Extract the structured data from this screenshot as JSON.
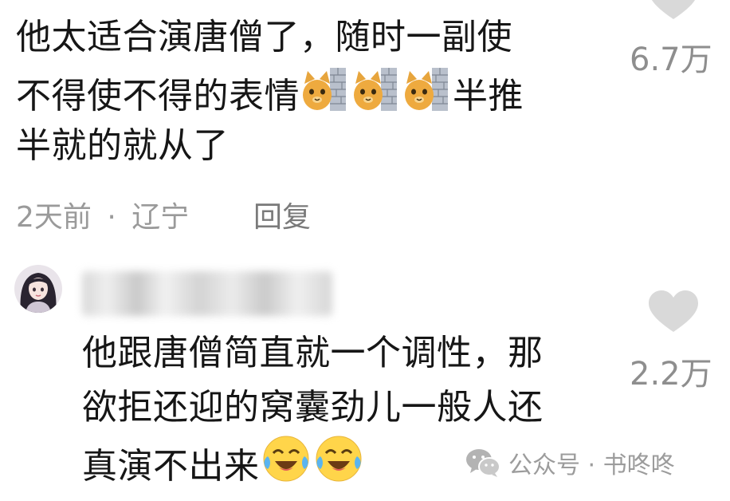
{
  "comment1": {
    "lines": [
      "他太适合演唐僧了，随时一副使",
      "不得使不得的表情",
      "半推",
      "半就的就从了"
    ],
    "emoji_name": "cat-wall-emoji",
    "likes": "6.7万",
    "time": "2天前",
    "separator": "·",
    "location": "辽宁",
    "reply_label": "回复"
  },
  "comment2": {
    "avatar_icon": "girl-avatar",
    "lines": [
      "他跟唐僧简直就一个调性，那",
      "欲拒还迎的窝囊劲儿一般人还",
      "真演不出来"
    ],
    "emoji_name": "tears-of-joy-emoji",
    "likes": "2.2万"
  },
  "watermark": {
    "icon": "wechat-icon",
    "text": "公众号 · 书咚咚"
  },
  "colors": {
    "text": "#161616",
    "meta": "#9a9a9a",
    "heart": "#d9d9d9"
  }
}
